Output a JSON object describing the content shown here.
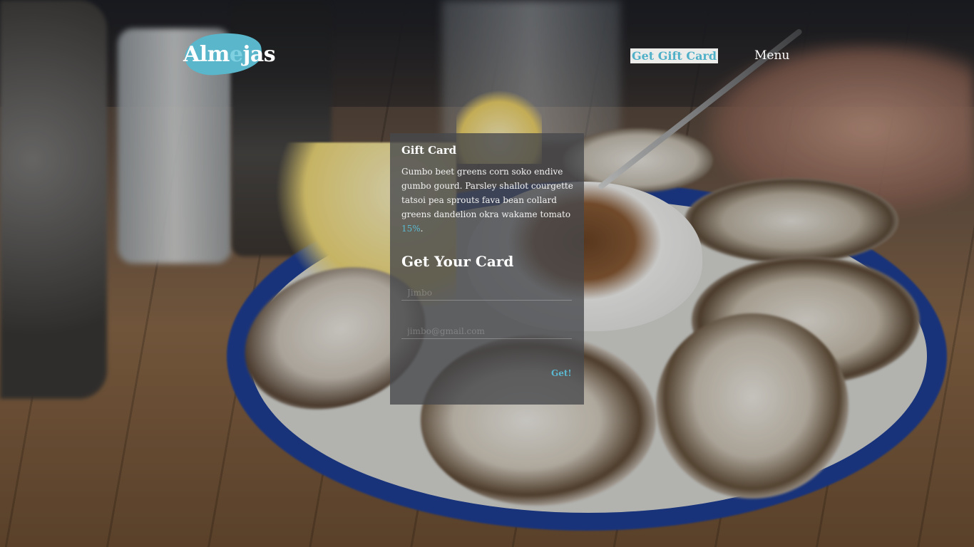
{
  "header": {
    "logo": {
      "text_main": "Alm",
      "text_accent": "e",
      "text_end": "jas",
      "color": "#5ab6cb"
    },
    "nav": {
      "gift_card": "Get Gift Card",
      "menu": "Menu"
    }
  },
  "gift_card": {
    "title": "Gift Card",
    "description": "Gumbo beet greens corn soko endive gumbo gourd. Parsley shallot courgette tatsoi pea sprouts fava bean collard greens dandelion okra wakame tomato ",
    "highlight": "15%",
    "period": ".",
    "form_title": "Get Your Card",
    "name_placeholder": "Jimbo",
    "email_placeholder": "jimbo@gmail.com",
    "submit_label": "Get!"
  },
  "colors": {
    "accent": "#5bb8d1",
    "panel": "#46484c",
    "nav_button_bg": "#ececea"
  }
}
